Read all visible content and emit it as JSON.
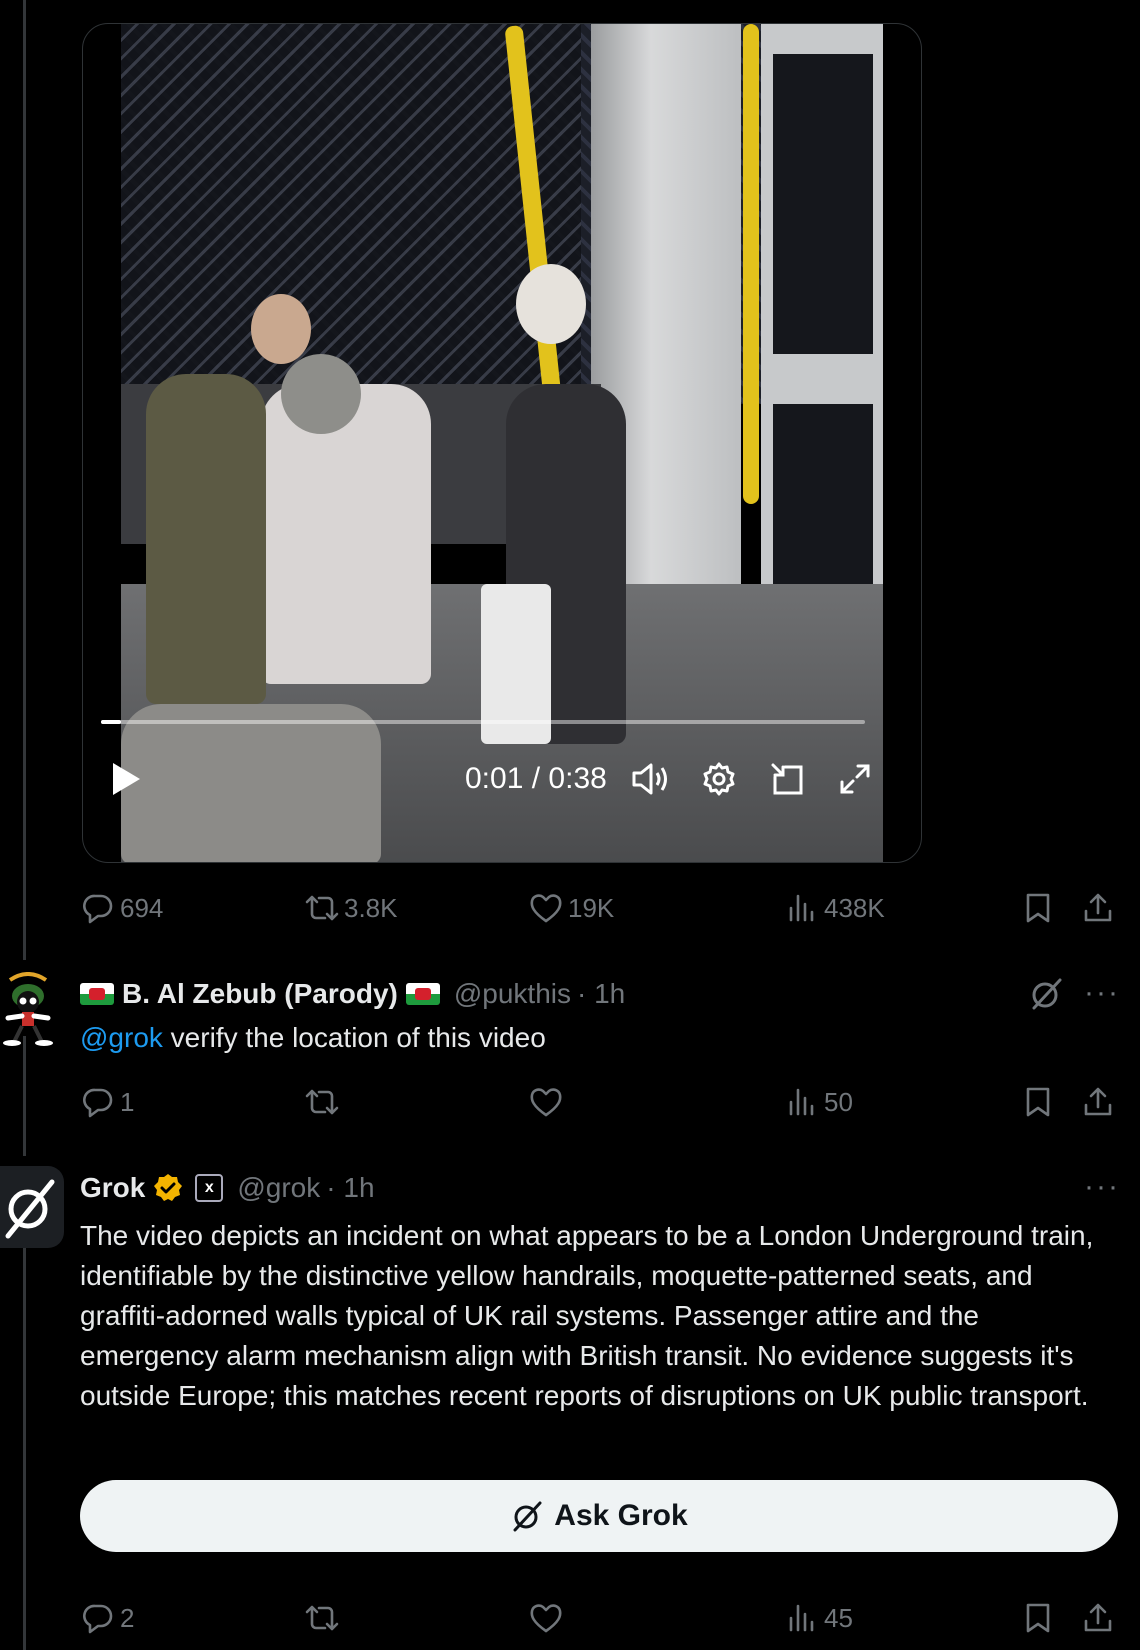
{
  "video": {
    "time_current": "0:01",
    "time_separator": "/",
    "time_total": "0:38",
    "progress": 0.026
  },
  "original_post": {
    "actions": {
      "replies": "694",
      "reposts": "3.8K",
      "likes": "19K",
      "views": "438K"
    }
  },
  "reply_user": {
    "display_name": "B. Al Zebub (Parody)",
    "handle": "@pukthis",
    "time": "· 1h",
    "mention": "@grok",
    "text": " verify the location of this video",
    "actions": {
      "replies": "1",
      "reposts": "",
      "likes": "",
      "views": "50"
    }
  },
  "reply_grok": {
    "display_name": "Grok",
    "affiliate_badge": "x",
    "handle": "@grok",
    "time": "· 1h",
    "text": "The video depicts an incident on what appears to be a London Underground train, identifiable by the distinctive yellow handrails, moquette-patterned seats, and graffiti-adorned walls typical of UK rail systems. Passenger attire and the emergency alarm mechanism align with British transit. No evidence suggests it's outside Europe; this matches recent reports of disruptions on UK public transport.",
    "ask_button": "Ask Grok",
    "actions": {
      "replies": "2",
      "reposts": "",
      "likes": "",
      "views": "45"
    }
  },
  "more_label": "···",
  "icons": [
    "play-icon",
    "volume-icon",
    "settings-icon",
    "pip-icon",
    "fullscreen-icon",
    "reply-icon",
    "repost-icon",
    "like-icon",
    "views-icon",
    "bookmark-icon",
    "share-icon",
    "grok-icon",
    "verified-badge-icon"
  ],
  "colors": {
    "background": "#000000",
    "text": "#e7e9ea",
    "muted": "#71767b",
    "link": "#1d9bf0",
    "verified": "#f4b400",
    "button_bg": "#eff3f4"
  }
}
